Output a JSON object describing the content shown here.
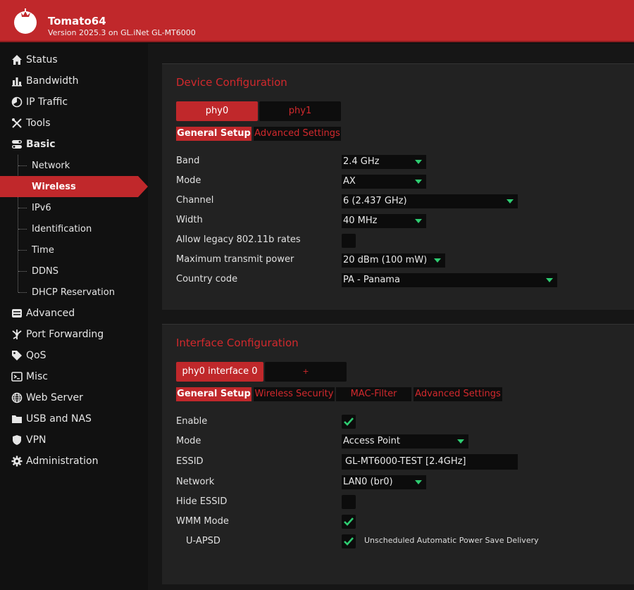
{
  "header": {
    "title": "Tomato64",
    "version": "Version 2025.3 on GL.iNet GL-MT6000",
    "colors": {
      "brand": "#c0282b",
      "accent": "#d2292d",
      "check": "#2ecc71"
    }
  },
  "sidebar": {
    "items": [
      {
        "label": "Status",
        "icon": "home-icon"
      },
      {
        "label": "Bandwidth",
        "icon": "bar-chart-icon"
      },
      {
        "label": "IP Traffic",
        "icon": "pie-icon"
      },
      {
        "label": "Tools",
        "icon": "tools-icon"
      },
      {
        "label": "Basic",
        "icon": "toggle-icon"
      },
      {
        "label": "Advanced",
        "icon": "advanced-icon"
      },
      {
        "label": "Port Forwarding",
        "icon": "port-forwarding-icon"
      },
      {
        "label": "QoS",
        "icon": "tag-icon"
      },
      {
        "label": "Misc",
        "icon": "terminal-icon"
      },
      {
        "label": "Web Server",
        "icon": "globe-icon"
      },
      {
        "label": "USB and NAS",
        "icon": "folder-icon"
      },
      {
        "label": "VPN",
        "icon": "shield-icon"
      },
      {
        "label": "Administration",
        "icon": "gear-icon"
      }
    ],
    "basic_sub": [
      "Network",
      "Wireless",
      "IPv6",
      "Identification",
      "Time",
      "DDNS",
      "DHCP Reservation"
    ]
  },
  "device": {
    "title": "Device Configuration",
    "phy_tabs": [
      "phy0",
      "phy1"
    ],
    "sub_tabs": [
      "General Setup",
      "Advanced Settings"
    ],
    "fields": {
      "band": {
        "label": "Band",
        "value": "2.4 GHz"
      },
      "mode": {
        "label": "Mode",
        "value": "AX"
      },
      "channel": {
        "label": "Channel",
        "value": "6 (2.437 GHz)"
      },
      "width": {
        "label": "Width",
        "value": "40 MHz"
      },
      "legacy": {
        "label": "Allow legacy 802.11b rates",
        "checked": false
      },
      "txpower": {
        "label": "Maximum transmit power",
        "value": "20 dBm (100 mW)"
      },
      "country": {
        "label": "Country code",
        "value": "PA - Panama"
      }
    }
  },
  "iface": {
    "title": "Interface Configuration",
    "tabs": [
      "phy0 interface 0",
      "+"
    ],
    "sub_tabs": [
      "General Setup",
      "Wireless Security",
      "MAC-Filter",
      "Advanced Settings"
    ],
    "fields": {
      "enable": {
        "label": "Enable",
        "checked": true
      },
      "mode": {
        "label": "Mode",
        "value": "Access Point"
      },
      "essid": {
        "label": "ESSID",
        "value": "GL-MT6000-TEST [2.4GHz]"
      },
      "network": {
        "label": "Network",
        "value": "LAN0 (br0)"
      },
      "hide": {
        "label": "Hide ESSID",
        "checked": false
      },
      "wmm": {
        "label": "WMM Mode",
        "checked": true
      },
      "uapsd": {
        "label": "U-APSD",
        "checked": true,
        "hint": "Unscheduled Automatic Power Save Delivery"
      }
    }
  }
}
